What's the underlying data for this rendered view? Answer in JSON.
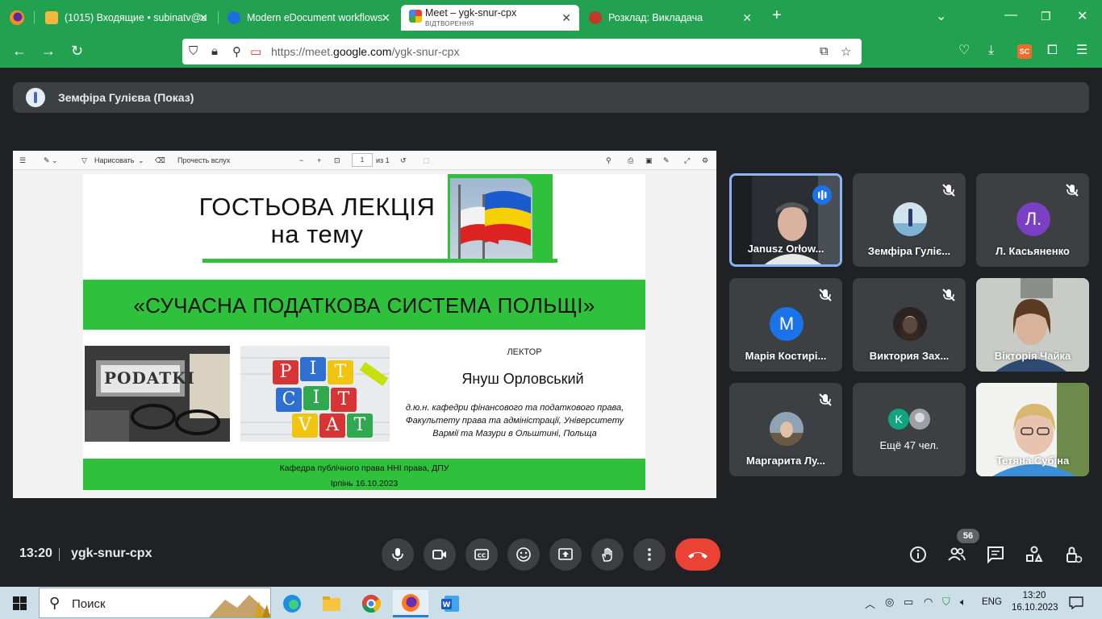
{
  "browser": {
    "tabs": [
      {
        "title": "(1015) Входящие • subinatv@u",
        "icon": "mail-icon"
      },
      {
        "title": "Modern eDocument workflows",
        "icon": "edocument-icon"
      },
      {
        "title": "Meet – ygk-snur-cpx",
        "subtitle": "ВІДТВОРЕННЯ",
        "icon": "meet-icon",
        "active": true
      },
      {
        "title": "Розклад: Викладача",
        "icon": "schedule-icon"
      }
    ],
    "url_prefix": "https://meet.",
    "url_domain": "google.com",
    "url_path": "/ygk-snur-cpx",
    "extension_label": "SC"
  },
  "meet": {
    "presenter_banner": "Земфіра Гулієва (Показ)",
    "clock": "13:20",
    "meeting_code": "ygk-snur-cpx",
    "participants_count": "56",
    "participants": [
      {
        "name": "Janusz Orłow...",
        "type": "video",
        "speaking": true
      },
      {
        "name": "Земфіра Гуліє...",
        "type": "photo",
        "muted": true
      },
      {
        "name": "Л. Касьяненко",
        "type": "letter",
        "letter": "Л.",
        "color": "#7b3fc4",
        "muted": true
      },
      {
        "name": "Марія Костирі...",
        "type": "letter",
        "letter": "М",
        "color": "#1a73e8",
        "muted": true
      },
      {
        "name": "Виктория Зах...",
        "type": "photo",
        "muted": true
      },
      {
        "name": "Вікторія Чайка",
        "type": "video"
      },
      {
        "name": "Маргарита Лу...",
        "type": "photo",
        "muted": true
      },
      {
        "name": "Ещё 47 чел.",
        "type": "more",
        "letter": "K",
        "color": "#12a37f"
      },
      {
        "name": "Тетяна Субіна",
        "type": "video"
      }
    ]
  },
  "pdf_toolbar": {
    "draw_label": "Нарисовать",
    "read_aloud_label": "Прочесть вслух",
    "page_number": "1",
    "page_total": "из 1"
  },
  "slide": {
    "title_line1": "ГОСТЬОВА ЛЕКЦІЯ",
    "title_line2": "на тему",
    "topic": "«СУЧАСНА ПОДАТКОВА СИСТЕМА ПОЛЬЩІ»",
    "podatki_label": "PODATKI",
    "cubes": [
      "P",
      "I",
      "T",
      "C",
      "I",
      "T",
      "V",
      "A",
      "T"
    ],
    "lector_label": "ЛЕКТОР",
    "lector_name": "Януш Орловський",
    "lector_desc": "д.ю.н. кафедри фінансового та податкового права, Факультету права та адміністрації, Університету Вармії та Мазури в Ольштині, Польща",
    "footer_line1": "Кафедра публічного права ННІ права, ДПУ",
    "footer_line2": "Ірпінь 16.10.2023"
  },
  "taskbar": {
    "search_placeholder": "Поиск",
    "lang": "ENG",
    "time": "13:20",
    "date": "16.10.2023"
  }
}
